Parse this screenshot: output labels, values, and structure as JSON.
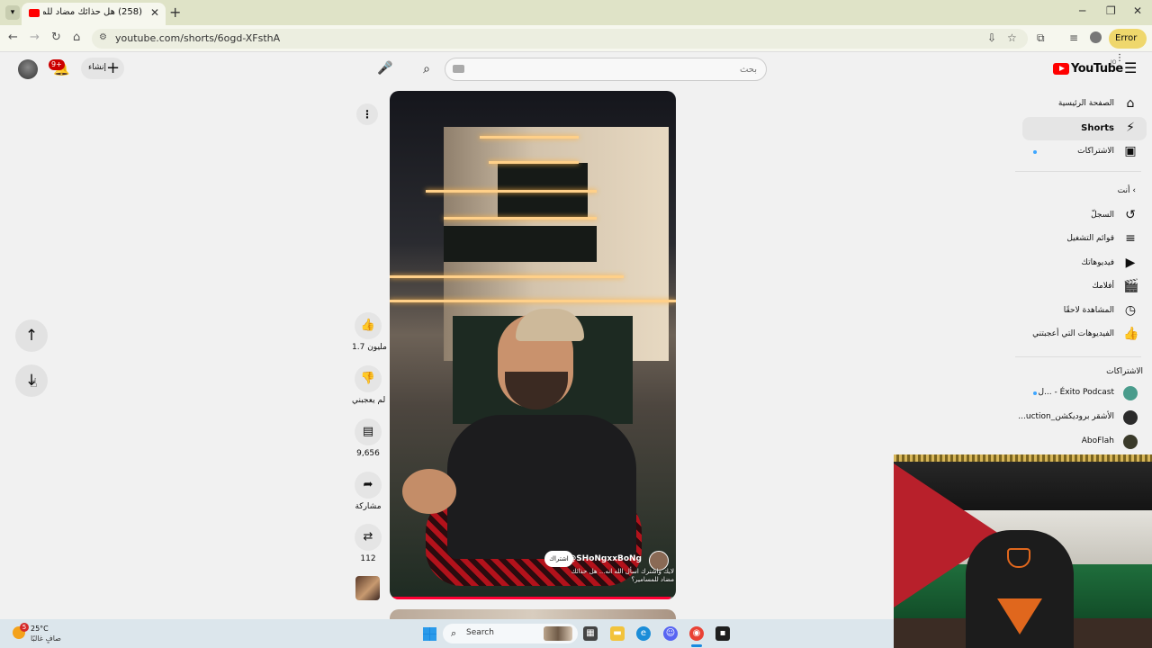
{
  "browser": {
    "tab_title": "(258) هل حذائك مضاد للمسا",
    "url": "youtube.com/shorts/6ogd-XFsthA",
    "error_label": "Error"
  },
  "header": {
    "notifications_badge": "9+",
    "create_label": "إنشاء",
    "search_placeholder": "بحث",
    "logo_text": "YouTube",
    "logo_region": "JO"
  },
  "sidebar": {
    "main": [
      {
        "label": "الصفحة الرئيسية",
        "icon": "home-icon"
      },
      {
        "label": "Shorts",
        "icon": "shorts-icon"
      },
      {
        "label": "الاشتراكات",
        "icon": "subscriptions-icon"
      }
    ],
    "you_section": "أنت",
    "you_items": [
      {
        "label": "السجلّ",
        "icon": "history-icon"
      },
      {
        "label": "قوائم التشغيل",
        "icon": "playlists-icon"
      },
      {
        "label": "فيديوهاتك",
        "icon": "your-videos-icon"
      },
      {
        "label": "أفلامك",
        "icon": "movies-icon"
      },
      {
        "label": "المشاهدة لاحقًا",
        "icon": "watch-later-icon"
      },
      {
        "label": "الفيديوهات التي أعجبتني",
        "icon": "liked-icon"
      }
    ],
    "subscriptions_section": "الاشتراكات",
    "subscriptions": [
      {
        "label": "Éxito Podcast - ...ل",
        "color": "#4a9c8c"
      },
      {
        "label": "الأشقر بروديكشن_uction...",
        "color": "#2b2b2b"
      },
      {
        "label": "AboFlah",
        "color": "#3a3a2a"
      }
    ]
  },
  "video": {
    "channel_handle": "@SHoNgxxBoNg",
    "subscribe_label": "اشتراك",
    "caption": "لايك واشترك اسأل الله انه... هل حذائك مضاد للمسامير؟",
    "progress": 0.98
  },
  "actions": {
    "like_count": "1.7 مليون",
    "dislike_label": "لم يعجبني",
    "comment_count": "9,656",
    "share_label": "مشاركة",
    "remix_count": "112"
  },
  "taskbar": {
    "weather_temp": "25°C",
    "weather_desc": "صافٍ غالبًا",
    "weather_badge": "5",
    "search_label": "Search"
  },
  "colors": {
    "youtube_red": "#ff0000",
    "accent_blue": "#3ea6ff"
  }
}
